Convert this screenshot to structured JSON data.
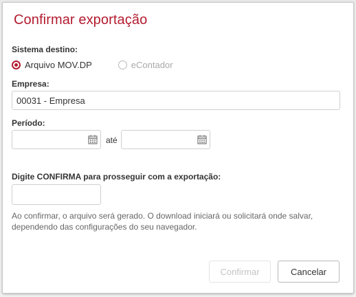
{
  "dialog": {
    "title": "Confirmar exportação",
    "sistema_label": "Sistema destino:",
    "radio_options": [
      {
        "label": "Arquivo MOV.DP",
        "selected": true
      },
      {
        "label": "eContador",
        "selected": false
      }
    ],
    "empresa_label": "Empresa:",
    "empresa_value": "00031 - Empresa",
    "periodo_label": "Período:",
    "periodo_from": "",
    "periodo_to": "",
    "ate_label": "até",
    "confirma_label": "Digite CONFIRMA para prosseguir com a exportação:",
    "confirma_value": "",
    "info_text": "Ao confirmar, o arquivo será gerado. O download iniciará ou solicitará onde salvar, dependendo das configurações do seu navegador.",
    "confirm_button": "Confirmar",
    "cancel_button": "Cancelar"
  },
  "colors": {
    "accent": "#b31b2f",
    "disabled_text": "#c4c4c4"
  },
  "icons": {
    "calendar": "calendar-icon"
  }
}
